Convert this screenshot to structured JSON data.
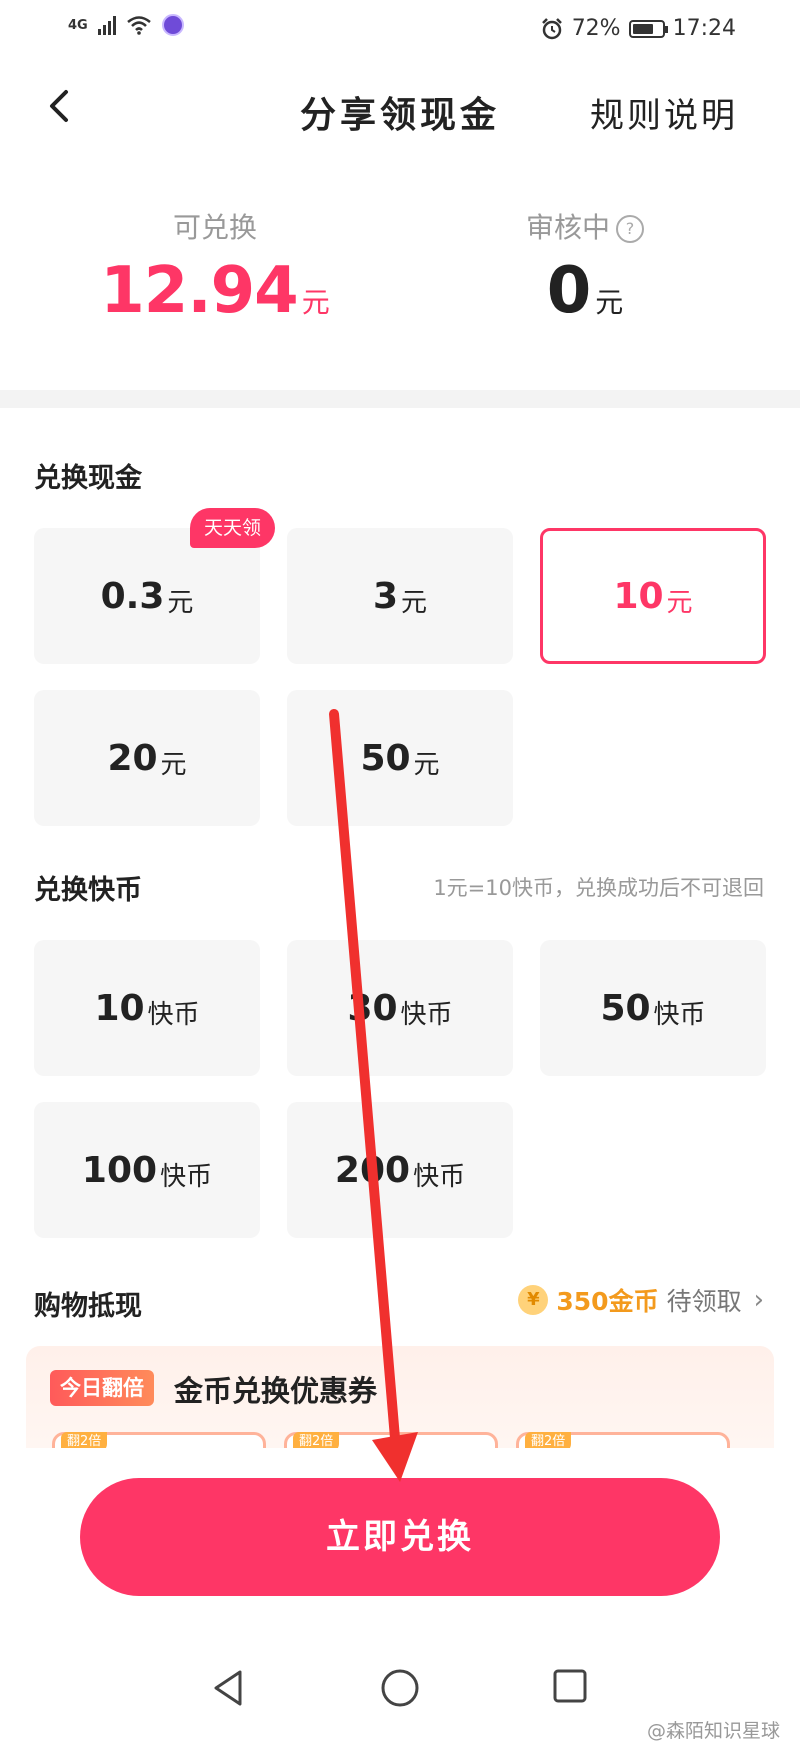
{
  "status_bar": {
    "network": "4G",
    "battery_percent_text": "72%",
    "battery_level": 0.72,
    "time": "17:24"
  },
  "nav": {
    "title": "分享领现金",
    "rules_label": "规则说明"
  },
  "balance": {
    "redeemable_label": "可兑换",
    "redeemable_value": "12.94",
    "redeemable_unit": "元",
    "reviewing_label": "审核中",
    "reviewing_value": "0",
    "reviewing_unit": "元"
  },
  "cash_exchange": {
    "title": "兑换现金",
    "badge": "天天领",
    "options": [
      {
        "value": "0.3",
        "unit": "元"
      },
      {
        "value": "3",
        "unit": "元"
      },
      {
        "value": "10",
        "unit": "元",
        "selected": true
      },
      {
        "value": "20",
        "unit": "元"
      },
      {
        "value": "50",
        "unit": "元"
      }
    ]
  },
  "coin_exchange": {
    "title": "兑换快币",
    "note": "1元=10快币，兑换成功后不可退回",
    "options": [
      {
        "value": "10",
        "unit": "快币"
      },
      {
        "value": "30",
        "unit": "快币"
      },
      {
        "value": "50",
        "unit": "快币"
      },
      {
        "value": "100",
        "unit": "快币"
      },
      {
        "value": "200",
        "unit": "快币"
      }
    ]
  },
  "shopping": {
    "title": "购物抵现",
    "coin_icon_glyph": "¥",
    "coins_amount": "350金币",
    "coins_tail": "待领取",
    "promo_tag": "今日翻倍",
    "promo_title": "金币兑换优惠券",
    "mini_tag": "翻2倍"
  },
  "action_button": "立即兑换",
  "watermark": "@森陌知识星球",
  "colors": {
    "accent": "#fe3666",
    "coin_orange": "#f39a1d",
    "annotation_arrow": "#f0302e"
  },
  "icons": [
    "back-arrow-icon",
    "help-icon",
    "coin-icon",
    "chevron-right-icon",
    "nav-back-triangle-icon",
    "nav-home-circle-icon",
    "nav-recent-square-icon"
  ]
}
